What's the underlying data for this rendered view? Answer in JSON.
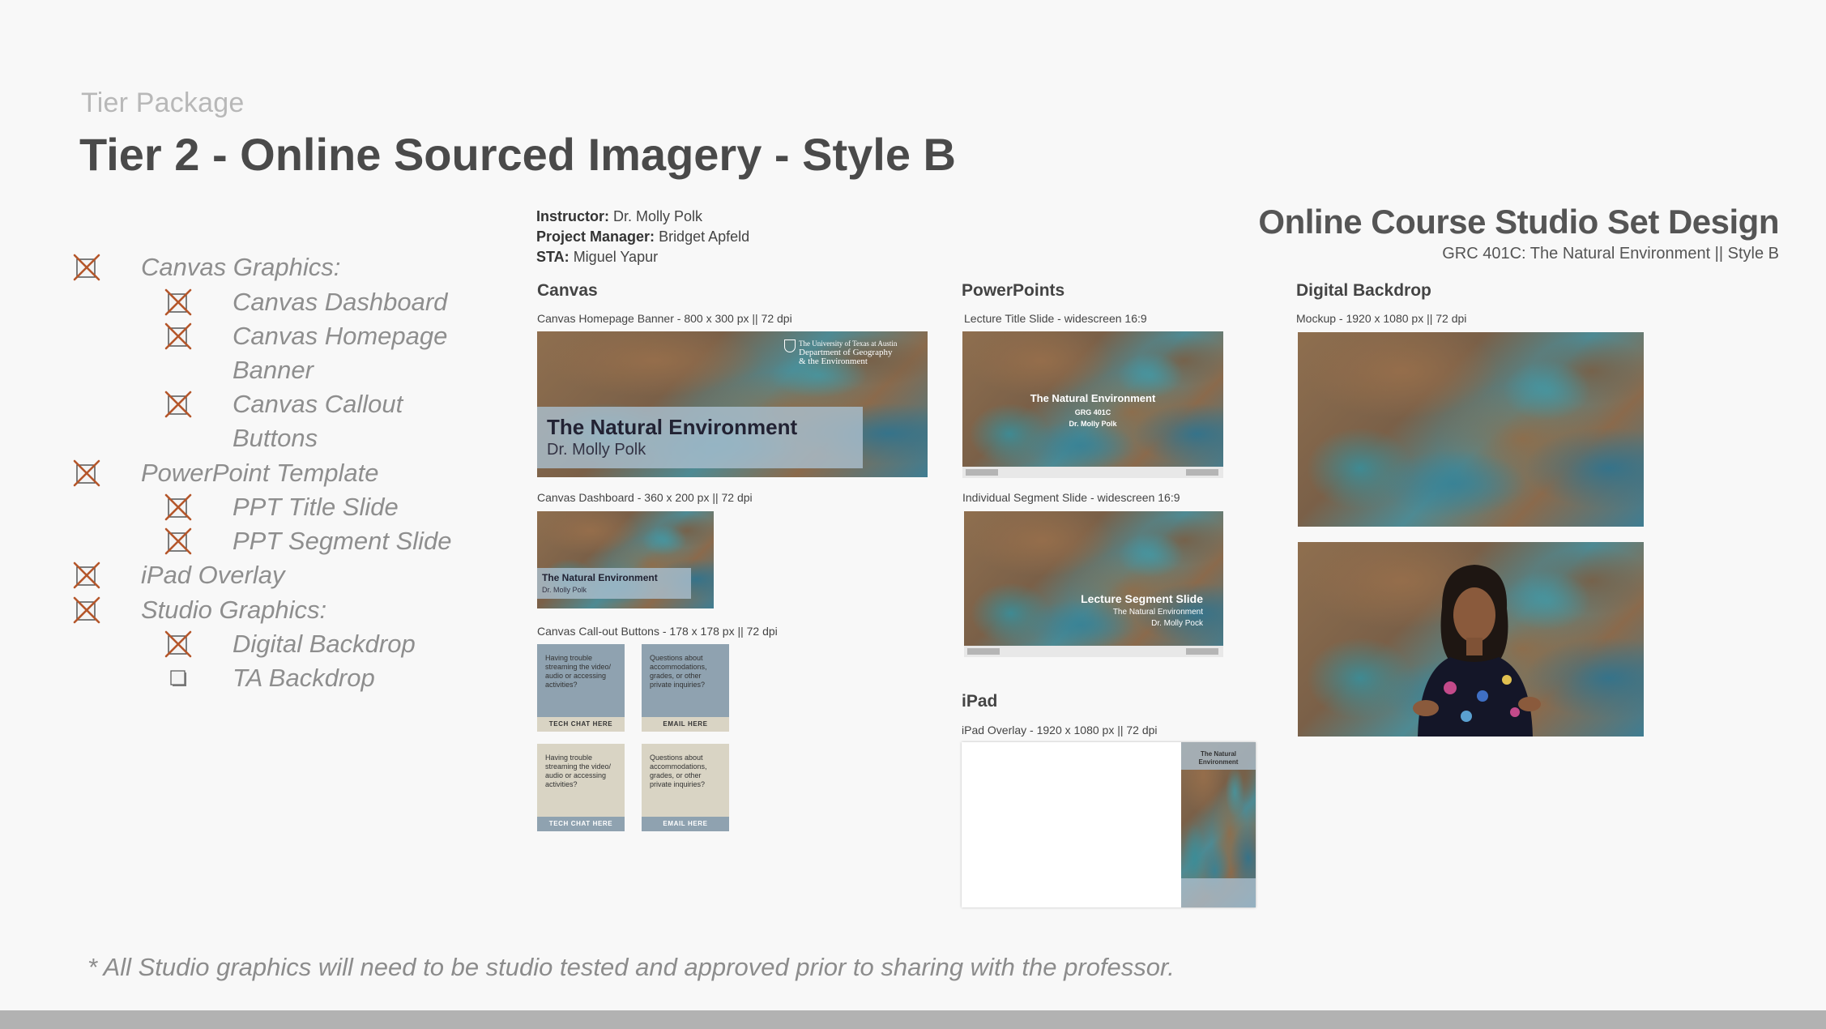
{
  "header": {
    "kicker": "Tier Package",
    "title": "Tier 2 - Online Sourced Imagery - Style B"
  },
  "checklist": [
    {
      "label": "Canvas Graphics:",
      "checked": true
    },
    {
      "label": "Canvas Dashboard",
      "checked": true
    },
    {
      "label": "Canvas Homepage",
      "checked": true
    },
    {
      "label": "Banner",
      "checked": null
    },
    {
      "label": "Canvas Callout",
      "checked": true
    },
    {
      "label": "Buttons",
      "checked": null
    },
    {
      "label": "PowerPoint Template",
      "checked": true
    },
    {
      "label": "PPT Title Slide",
      "checked": true
    },
    {
      "label": "PPT Segment Slide",
      "checked": true
    },
    {
      "label": "iPad Overlay",
      "checked": true
    },
    {
      "label": "Studio Graphics:",
      "checked": true
    },
    {
      "label": "Digital Backdrop",
      "checked": true
    },
    {
      "label": "TA Backdrop",
      "checked": false
    }
  ],
  "footnote": "* All Studio graphics will need to be studio tested and approved prior to sharing with the professor.",
  "board": {
    "meta": {
      "instructor_label": "Instructor:",
      "instructor": "Dr. Molly Polk",
      "pm_label": "Project Manager:",
      "pm": "Bridget Apfeld",
      "sta_label": "STA:",
      "sta": "Miguel Yapur"
    },
    "title": "Online Course Studio Set Design",
    "subtitle": "GRC 401C: The Natural Environment   ||   Style B",
    "canvas": {
      "heading": "Canvas",
      "banner_caption": "Canvas Homepage Banner - 800 x 300 px || 72 dpi",
      "banner_title": "The Natural Environment",
      "banner_name": "Dr. Molly Polk",
      "dept_line1": "The University of Texas at Austin",
      "dept_line2": "Department of Geography",
      "dept_line3": "& the Environment",
      "dashboard_caption": "Canvas Dashboard - 360 x 200 px || 72 dpi",
      "dashboard_title": "The Natural Environment",
      "dashboard_name": "Dr. Molly Polk",
      "callout_caption": "Canvas Call-out Buttons - 178 x 178 px || 72 dpi",
      "callouts": [
        {
          "text": "Having trouble streaming the video/ audio or accessing activities?",
          "button": "TECH CHAT HERE"
        },
        {
          "text": "Questions about accommodations, grades, or other private inquiries?",
          "button": "EMAIL HERE"
        },
        {
          "text": "Having trouble streaming the video/ audio or accessing activities?",
          "button": "TECH CHAT HERE"
        },
        {
          "text": "Questions about accommodations, grades, or other private inquiries?",
          "button": "EMAIL HERE"
        }
      ]
    },
    "powerpoints": {
      "heading": "PowerPoints",
      "title_caption": "Lecture Title Slide - widescreen 16:9",
      "title_slide_title": "The Natural Environment",
      "title_slide_code": "GRG 401C",
      "title_slide_name": "Dr. Molly Polk",
      "segment_caption": "Individual Segment Slide - widescreen 16:9",
      "segment_title": "Lecture Segment Slide",
      "segment_course": "The Natural Environment",
      "segment_name": "Dr. Molly Pock"
    },
    "ipad": {
      "heading": "iPad",
      "caption": "iPad Overlay - 1920 x 1080 px || 72 dpi",
      "strip_title": "The Natural Environment"
    },
    "backdrop": {
      "heading": "Digital Backdrop",
      "caption": "Mockup - 1920 x 1080 px || 72 dpi"
    }
  }
}
